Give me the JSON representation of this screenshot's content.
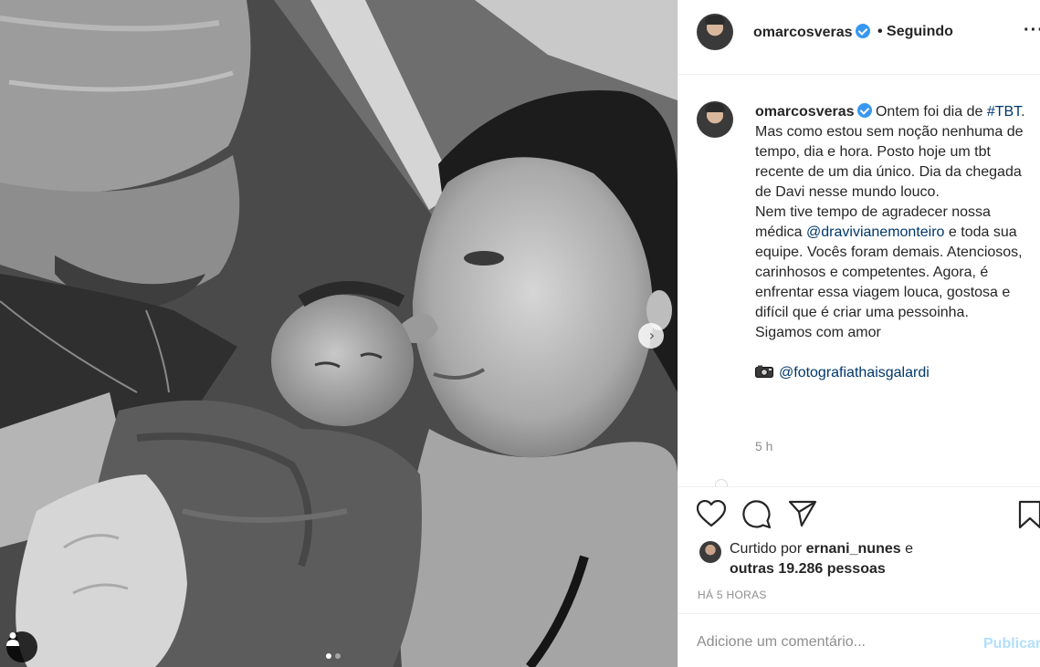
{
  "post": {
    "username": "omarcosveras",
    "follow_status": "• Seguindo",
    "more": "···",
    "caption": {
      "intro": "Ontem foi dia de",
      "hashtag": "#TBT",
      "line1": ". Mas como estou sem noção nenhuma de tempo, dia e hora. Posto hoje um tbt recente de um dia único. Dia da chegada de Davi nesse mundo louco.",
      "line2_a": "Nem tive tempo de agradecer nossa médica",
      "mention1": "@dravivianemonteiro",
      "line2_b": "e toda sua equipe. Vocês foram demais. Atenciosos, carinhosos e competentes. Agora, é enfrentar essa viagem louca, gostosa e difícil que é criar uma pessoinha.",
      "line3": "Sigamos com amor",
      "mention2": "@fotografiathaisgalardi"
    },
    "caption_time": "5 h",
    "likes": {
      "prefix": "Curtido por",
      "first_liker": "ernani_nunes",
      "conj": "e",
      "others": "outras 19.286 pessoas"
    },
    "post_time": "HÁ 5 HORAS",
    "comment_placeholder": "Adicione um comentário...",
    "publish_label": "Publicar"
  },
  "carousel": {
    "total": 2,
    "current": 1
  },
  "icons": {
    "verified": "verified-badge-icon",
    "like": "heart-icon",
    "comment": "speech-bubble-icon",
    "share": "paper-plane-icon",
    "save": "bookmark-icon",
    "next": "chevron-right-icon",
    "tag": "user-tag-icon",
    "camera": "camera-icon"
  },
  "colors": {
    "link": "#00376b",
    "verified": "#3897f0",
    "publish_disabled": "#b2dffc",
    "muted": "#8e8e8e"
  }
}
